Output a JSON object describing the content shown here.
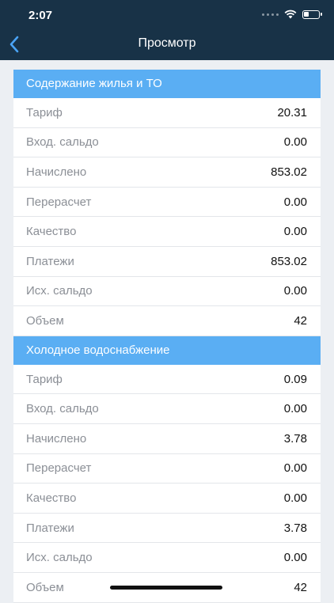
{
  "status_bar": {
    "time": "2:07"
  },
  "nav": {
    "title": "Просмотр",
    "back_icon": "chevron-left-icon"
  },
  "sections": [
    {
      "title": "Содержание жилья и ТО",
      "rows": [
        {
          "label": "Тариф",
          "value": "20.31"
        },
        {
          "label": "Вход. сальдо",
          "value": "0.00"
        },
        {
          "label": "Начислено",
          "value": "853.02"
        },
        {
          "label": "Перерасчет",
          "value": "0.00"
        },
        {
          "label": "Качество",
          "value": "0.00"
        },
        {
          "label": "Платежи",
          "value": "853.02"
        },
        {
          "label": "Исх. сальдо",
          "value": "0.00"
        },
        {
          "label": "Объем",
          "value": "42"
        }
      ]
    },
    {
      "title": "Холодное водоснабжение",
      "rows": [
        {
          "label": "Тариф",
          "value": "0.09"
        },
        {
          "label": "Вход. сальдо",
          "value": "0.00"
        },
        {
          "label": "Начислено",
          "value": "3.78"
        },
        {
          "label": "Перерасчет",
          "value": "0.00"
        },
        {
          "label": "Качество",
          "value": "0.00"
        },
        {
          "label": "Платежи",
          "value": "3.78"
        },
        {
          "label": "Исх. сальдо",
          "value": "0.00"
        },
        {
          "label": "Объем",
          "value": "42"
        }
      ]
    }
  ],
  "colors": {
    "header_bg": "#183247",
    "section_header_bg": "#5aaef3",
    "back_icon": "#4aa3f5"
  }
}
